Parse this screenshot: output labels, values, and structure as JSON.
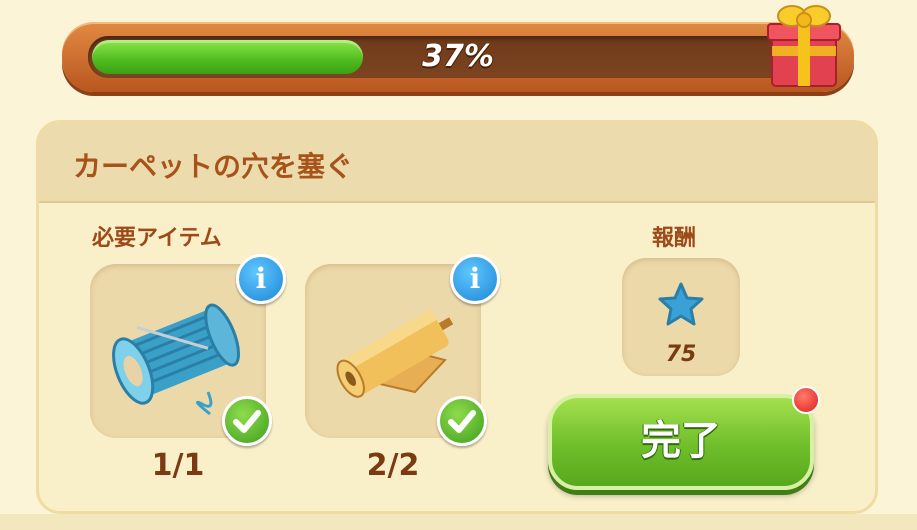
{
  "progress": {
    "percent": 37,
    "label": "37%"
  },
  "quest": {
    "title": "カーペットの穴を塞ぐ",
    "required_label": "必要アイテム",
    "reward_label": "報酬",
    "items": [
      {
        "name": "thread-spool",
        "count": "1/1",
        "complete": true
      },
      {
        "name": "fabric-roll",
        "count": "2/2",
        "complete": true
      }
    ],
    "reward": {
      "icon": "blue-star-icon",
      "value": "75"
    },
    "complete_button": "完了"
  },
  "colors": {
    "progress_fill": "#4fbb1e",
    "button_green": "#6fbe2a",
    "title_brown": "#a8531a",
    "info_blue": "#1e86d6",
    "star_blue": "#3aa0d8"
  }
}
